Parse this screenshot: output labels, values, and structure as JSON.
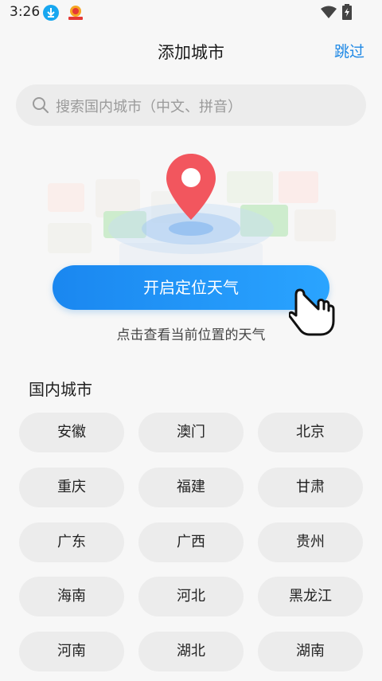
{
  "status_bar": {
    "time": "3:26"
  },
  "header": {
    "title": "添加城市",
    "skip_label": "跳过"
  },
  "search": {
    "placeholder": "搜索国内城市（中文、拼音）"
  },
  "locate": {
    "button_label": "开启定位天气",
    "hint": "点击查看当前位置的天气"
  },
  "cities": {
    "section_title": "国内城市",
    "items": [
      {
        "name": "安徽"
      },
      {
        "name": "澳门"
      },
      {
        "name": "北京"
      },
      {
        "name": "重庆"
      },
      {
        "name": "福建"
      },
      {
        "name": "甘肃"
      },
      {
        "name": "广东"
      },
      {
        "name": "广西"
      },
      {
        "name": "贵州"
      },
      {
        "name": "海南"
      },
      {
        "name": "河北"
      },
      {
        "name": "黑龙江"
      },
      {
        "name": "河南"
      },
      {
        "name": "湖北"
      },
      {
        "name": "湖南"
      }
    ]
  },
  "colors": {
    "accent": "#1e88e5",
    "pin": "#f2565e",
    "chip_bg": "#ececec",
    "background": "#f7f7f7"
  }
}
